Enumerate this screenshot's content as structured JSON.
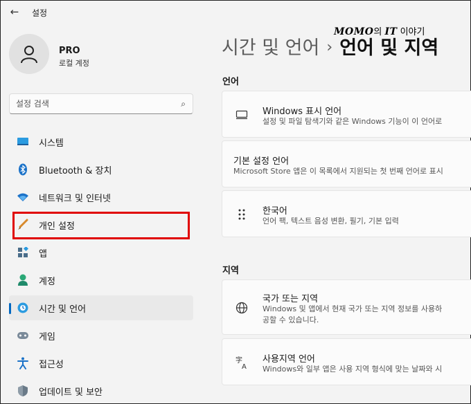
{
  "titlebar": {
    "title": "설정"
  },
  "watermark": {
    "brand": "MOMO",
    "mid": "의 ",
    "brand2": "IT",
    "tail": " 이야기"
  },
  "user": {
    "name": "PRO",
    "account_type": "로컬 계정"
  },
  "search": {
    "placeholder": "설정 검색"
  },
  "nav": {
    "items": [
      {
        "label": "시스템",
        "icon": "system-icon"
      },
      {
        "label": "Bluetooth & 장치",
        "icon": "bluetooth-icon"
      },
      {
        "label": "네트워크 및 인터넷",
        "icon": "wifi-icon"
      },
      {
        "label": "개인 설정",
        "icon": "brush-icon"
      },
      {
        "label": "앱",
        "icon": "apps-icon"
      },
      {
        "label": "계정",
        "icon": "account-icon"
      },
      {
        "label": "시간 및 언어",
        "icon": "globe-clock-icon",
        "active": true
      },
      {
        "label": "게임",
        "icon": "gamepad-icon"
      },
      {
        "label": "접근성",
        "icon": "accessibility-icon"
      },
      {
        "label": "업데이트 및 보안",
        "icon": "shield-icon"
      }
    ]
  },
  "breadcrumb": {
    "parent": "시간 및 언어",
    "separator": "›",
    "current": "언어 및 지역"
  },
  "language_section": {
    "title": "언어",
    "cards": [
      {
        "title": "Windows 표시 언어",
        "desc": "설정 및 파일 탐색기와 같은 Windows 기능이 이 언어로"
      },
      {
        "title": "기본 설정 언어",
        "desc": "Microsoft Store 앱은 이 목록에서 지원되는 첫 번째 언어로 표시"
      },
      {
        "title": "한국어",
        "desc": "언어 팩, 텍스트 음성 변환, 필기, 기본 입력"
      }
    ]
  },
  "region_section": {
    "title": "지역",
    "cards": [
      {
        "title": "국가 또는 지역",
        "desc_line1": "Windows 및 앱에서 현재 국가 또는 지역 정보를 사용하",
        "desc_line2": "공할 수 있습니다."
      },
      {
        "title": "사용지역 언어",
        "desc": "Windows와 일부 앱은 사용 지역 형식에 맞는 날짜와 시"
      }
    ]
  },
  "colors": {
    "accent": "#0067c0",
    "highlight": "#e00000"
  }
}
